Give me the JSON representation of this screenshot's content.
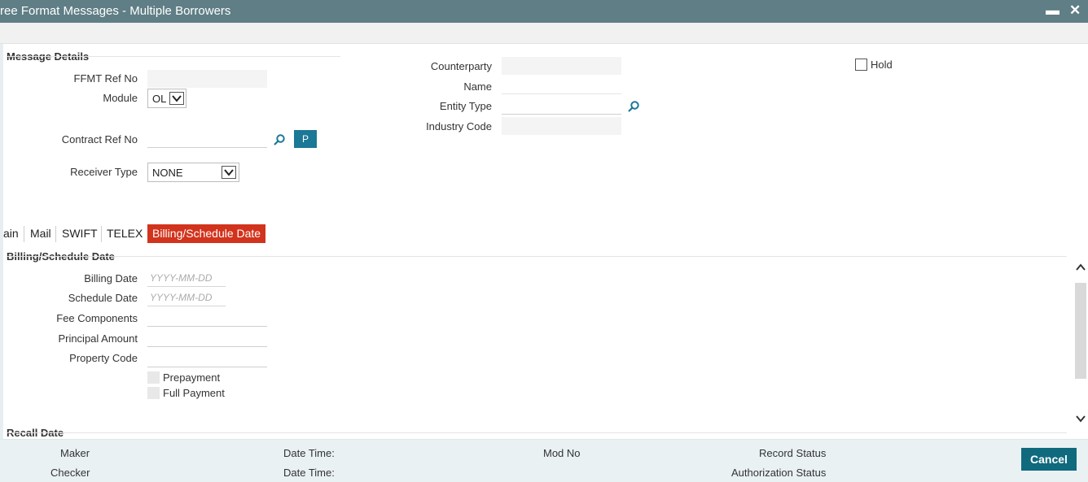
{
  "window": {
    "title": "ree Format Messages - Multiple Borrowers",
    "minimize": "▬",
    "close": "✕"
  },
  "message_details": {
    "heading": "Message Details",
    "ffmt_ref_no_label": "FFMT Ref No",
    "module_label": "Module",
    "module_value": "OL",
    "contract_ref_no_label": "Contract Ref No",
    "p_button": "P",
    "receiver_type_label": "Receiver Type",
    "receiver_type_value": "NONE",
    "counterparty_label": "Counterparty",
    "name_label": "Name",
    "entity_type_label": "Entity Type",
    "industry_code_label": "Industry Code",
    "hold_label": "Hold"
  },
  "tabs": [
    {
      "label": "ain"
    },
    {
      "label": "Mail"
    },
    {
      "label": "SWIFT"
    },
    {
      "label": "TELEX"
    },
    {
      "label": "Billing/Schedule Date"
    }
  ],
  "billing": {
    "heading": "Billing/Schedule Date",
    "billing_date_label": "Billing Date",
    "billing_date_placeholder": "YYYY-MM-DD",
    "schedule_date_label": "Schedule Date",
    "schedule_date_placeholder": "YYYY-MM-DD",
    "fee_components_label": "Fee Components",
    "principal_amount_label": "Principal Amount",
    "property_code_label": "Property Code",
    "prepayment_label": "Prepayment",
    "full_payment_label": "Full Payment"
  },
  "recall": {
    "heading": "Recall Date"
  },
  "footer": {
    "maker_label": "Maker",
    "checker_label": "Checker",
    "date_time_label_1": "Date Time:",
    "date_time_label_2": "Date Time:",
    "mod_no_label": "Mod No",
    "record_status_label": "Record Status",
    "authorization_status_label": "Authorization Status",
    "cancel_button": "Cancel"
  },
  "colors": {
    "titlebar": "#5f7e85",
    "active_tab": "#d2331c",
    "primary_button": "#0f6a7e",
    "lookup_button": "#1b7896",
    "footer_bg": "#e9f1f3"
  }
}
